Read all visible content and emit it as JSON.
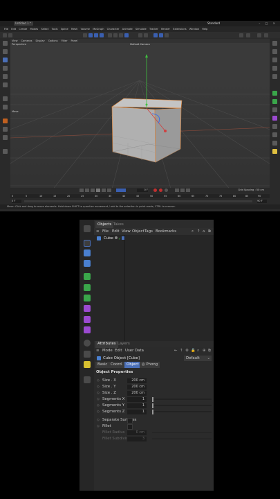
{
  "top_app": {
    "titlebar": {
      "tab_label": "Untitled 1 *",
      "layout_label": "Standard"
    },
    "menu": [
      "File",
      "Edit",
      "Create",
      "Modes",
      "Select",
      "Tools",
      "Spline",
      "Mesh",
      "Volume",
      "MoGraph",
      "Character",
      "Animate",
      "Simulate",
      "Tracker",
      "Render",
      "Extensions",
      "Window",
      "Help"
    ],
    "viewport": {
      "menu": [
        "View",
        "Cameras",
        "Display",
        "Options",
        "Filter",
        "Panel"
      ],
      "camera_label": "Default Camera",
      "perspective_label": "Perspective",
      "move_label": "Move",
      "grid_spacing": "Grid Spacing : 50 cm"
    },
    "timeline": {
      "frame_start": "0 F",
      "frame_current": "0 F",
      "frame_end": "90 F",
      "ticks": [
        "0",
        "5",
        "10",
        "15",
        "20",
        "25",
        "30",
        "35",
        "40",
        "45",
        "50",
        "55",
        "60",
        "65",
        "70",
        "75",
        "80",
        "85",
        "90"
      ]
    },
    "status": "Move: Click and drag to move elements. Hold down SHIFT to quantize movement / add to the selection in point mode, CTRL to remove."
  },
  "object_manager": {
    "tabs": {
      "objects": "Objects",
      "takes": "Takes"
    },
    "menu": {
      "file": "File",
      "edit": "Edit",
      "view": "View",
      "object": "Object",
      "tags": "Tags",
      "bookmarks": "Bookmarks"
    },
    "row": {
      "name": "Cube"
    }
  },
  "attributes": {
    "tabs": {
      "attributes": "Attributes",
      "layers": "Layers"
    },
    "menu": {
      "mode": "Mode",
      "edit": "Edit",
      "user_data": "User Data"
    },
    "object_label": "Cube Object [Cube]",
    "preset": "Default",
    "subtabs": {
      "basic": "Basic",
      "coord": "Coord.",
      "object": "Object",
      "phong": "Phong"
    },
    "section_title": "Object Properties",
    "size_x": {
      "label": "Size . X",
      "value": "200 cm"
    },
    "size_y": {
      "label": "Size . Y",
      "value": "200 cm"
    },
    "size_z": {
      "label": "Size . Z",
      "value": "200 cm"
    },
    "seg_x": {
      "label": "Segments X",
      "value": "1"
    },
    "seg_y": {
      "label": "Segments Y",
      "value": "1"
    },
    "seg_z": {
      "label": "Segments Z",
      "value": "1"
    },
    "separate_surfaces": {
      "label": "Separate Surfaces"
    },
    "fillet": {
      "label": "Fillet"
    },
    "fillet_radius": {
      "label": "Fillet Radius",
      "value": "0 cm"
    },
    "fillet_subdivision": {
      "label": "Fillet Subdivision",
      "value": "3"
    }
  },
  "colors": {
    "accent_blue": "#4a6fb7",
    "axis_x": "#d04040",
    "axis_y": "#40c040",
    "axis_z": "#4070e0",
    "cube": "#b4b4b4"
  }
}
